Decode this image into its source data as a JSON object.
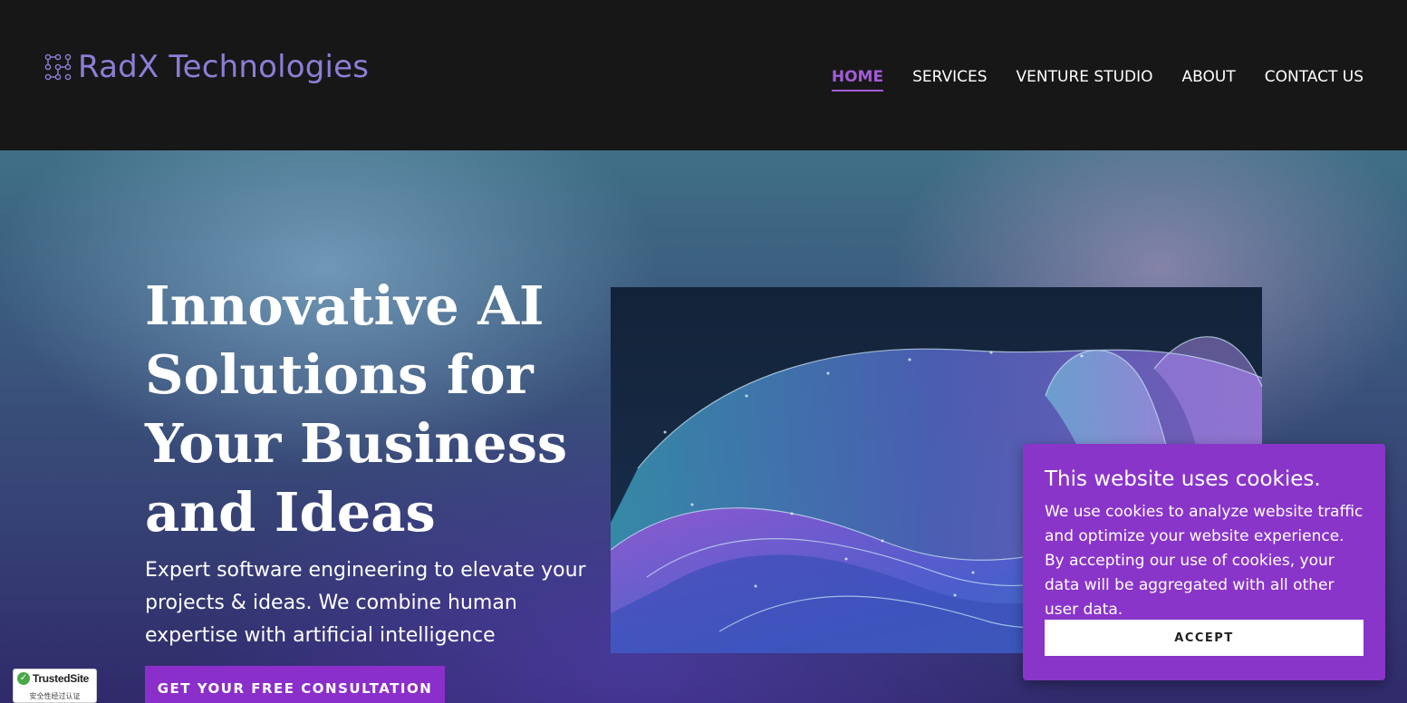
{
  "header": {
    "logo_text": "RadX Technologies",
    "logo_icon": "dot-grid-icon",
    "nav": [
      {
        "label": "HOME",
        "active": true
      },
      {
        "label": "SERVICES",
        "active": false
      },
      {
        "label": "VENTURE STUDIO",
        "active": false
      },
      {
        "label": "ABOUT",
        "active": false
      },
      {
        "label": "CONTACT US",
        "active": false
      }
    ]
  },
  "hero": {
    "headline": "Innovative AI Solutions for Your Business and Ideas",
    "subtext": "Expert software engineering to elevate your projects & ideas. We combine human expertise with artificial intelligence",
    "cta_label": "GET YOUR FREE CONSULTATION"
  },
  "cookie_banner": {
    "title": "This website uses cookies.",
    "text": "We use cookies to analyze website traffic and optimize your website experience. By accepting our use of cookies, your data will be aggregated with all other user data.",
    "accept_label": "ACCEPT"
  },
  "trust_badge": {
    "name": "TrustedSite",
    "subtitle": "安全性经过认证",
    "icon": "check-icon"
  },
  "colors": {
    "accent": "#8a35c9",
    "nav_active": "#a35bd9",
    "logo": "#8b7fd6",
    "header_bg": "#171717"
  }
}
